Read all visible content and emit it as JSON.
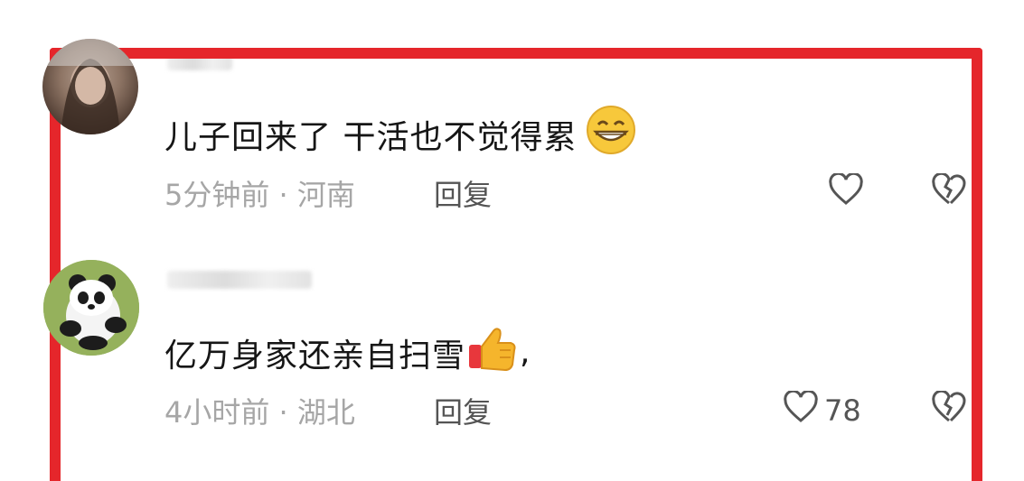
{
  "comments": [
    {
      "text": "儿子回来了 干活也不觉得累",
      "emoji": "grin-emoji",
      "time": "5分钟前",
      "dot": "·",
      "location": "河南",
      "reply_label": "回复",
      "likes": ""
    },
    {
      "text": "亿万身家还亲自扫雪",
      "emoji": "thumbs-up-emoji",
      "trailing": ",",
      "time": "4小时前",
      "dot": "·",
      "location": "湖北",
      "reply_label": "回复",
      "likes": "78"
    }
  ],
  "colors": {
    "highlight_border": "#e5262b",
    "meta_text": "#a6a6a6",
    "reply_text": "#545454"
  }
}
